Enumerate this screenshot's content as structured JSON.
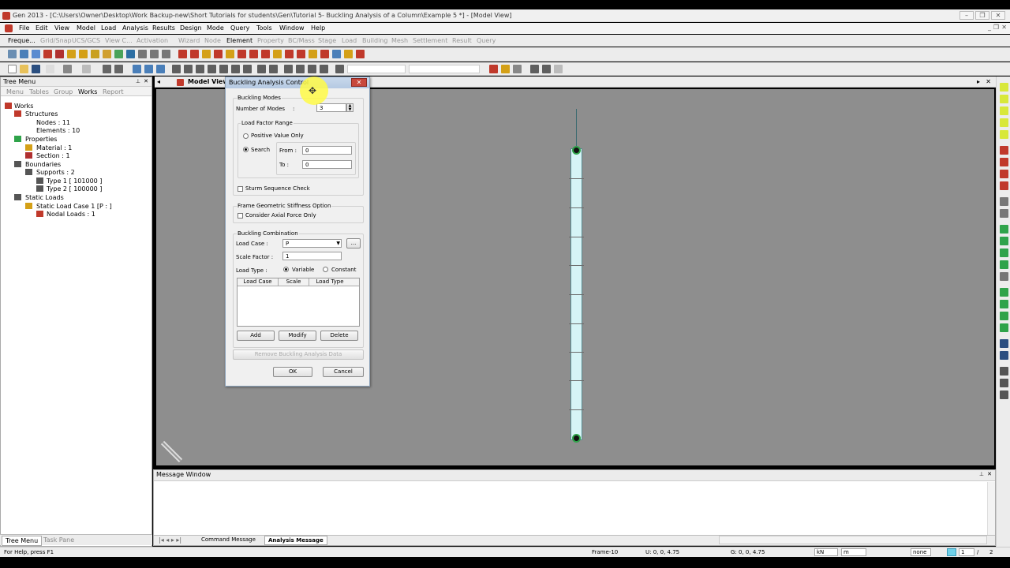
{
  "window": {
    "title": "Gen 2013 - [C:\\Users\\Owner\\Desktop\\Work Backup-new\\Short Tutorials for students\\Gen\\Tutorial 5- Buckling Analysis of a Column\\Example 5 *] - [Model View]"
  },
  "menu": [
    "File",
    "Edit",
    "View",
    "Model",
    "Load",
    "Analysis",
    "Results",
    "Design",
    "Mode",
    "Query",
    "Tools",
    "Window",
    "Help"
  ],
  "ribbon_tabs": [
    "Freque...",
    "Grid/Snap",
    "UCS/GCS",
    "View C...",
    "Activation",
    "Wizard",
    "Node",
    "Element",
    "Property",
    "BC/Mass",
    "Stage",
    "Load",
    "Building",
    "Mesh",
    "Settlement",
    "Result",
    "Query"
  ],
  "active_ribbon_tab": "Element",
  "tree": {
    "header": "Tree Menu",
    "tabs": [
      "Menu",
      "Tables",
      "Group",
      "Works",
      "Report"
    ],
    "active_tab": "Works",
    "items": [
      "Works",
      "Structures",
      "Nodes : 11",
      "Elements : 10",
      "Properties",
      "Material : 1",
      "Section : 1",
      "Boundaries",
      "Supports : 2",
      "Type 1 [ 101000 ]",
      "Type 2 [ 100000 ]",
      "Static Loads",
      "Static Load Case 1 [P : ]",
      "Nodal Loads : 1"
    ]
  },
  "view": {
    "tab_label": "Model View"
  },
  "dialog": {
    "title": "Buckling Analysis Control",
    "buckling_modes_group": "Buckling Modes",
    "number_of_modes_label": "Number of Modes",
    "colon": ":",
    "number_of_modes_value": "3",
    "load_factor_group": "Load Factor Range",
    "positive_only": "Positive Value Only",
    "search": "Search",
    "from_label": "From :",
    "from_value": "0",
    "to_label": "To :",
    "to_value": "0",
    "sturm": "Sturm Sequence Check",
    "frame_geo_group": "Frame Geometric Stiffness Option",
    "axial_force": "Consider Axial Force Only",
    "buckling_comb_group": "Buckling Combination",
    "load_case_label": "Load Case :",
    "load_case_value": "P",
    "ellipsis": "...",
    "scale_factor_label": "Scale Factor :",
    "scale_factor_value": "1",
    "load_type_label": "Load Type :",
    "variable": "Variable",
    "constant": "Constant",
    "table_headers": [
      "Load Case",
      "Scale",
      "Load Type"
    ],
    "add": "Add",
    "modify": "Modify",
    "delete": "Delete",
    "remove": "Remove Buckling Analysis Data",
    "ok": "OK",
    "cancel": "Cancel"
  },
  "message_window": {
    "title": "Message Window",
    "tabs": [
      "Command Message",
      "Analysis Message"
    ],
    "active_tab": "Analysis Message"
  },
  "bottom_tabs": [
    "Tree Menu",
    "Task Pane"
  ],
  "status": {
    "help": "For Help, press F1",
    "frame": "Frame-10",
    "u": "U: 0, 0, 4.75",
    "g": "G: 0, 0, 4.75",
    "force_unit": "kN",
    "length_unit": "m",
    "snap": "none",
    "page_current": "1",
    "page_sep": "/",
    "page_total": "2"
  },
  "colors": {
    "viewport": "#8e8e8e",
    "column_fill": "#d6f4f6",
    "node_ring": "#2fa34a",
    "highlight": "#fff946"
  }
}
